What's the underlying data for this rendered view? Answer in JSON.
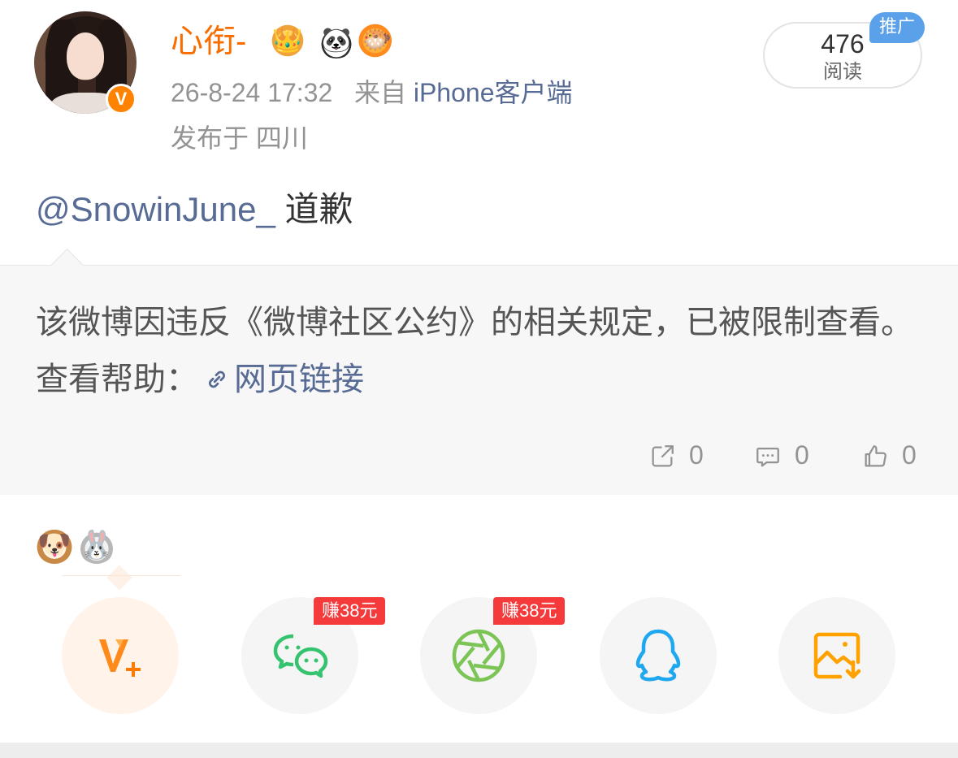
{
  "header": {
    "username": "心衔-",
    "verified_mark": "V",
    "badges": [
      {
        "name": "crown-badge-icon",
        "glyph": "👑"
      },
      {
        "name": "panda-badge-icon",
        "glyph": "🐼"
      },
      {
        "name": "fish-badge-icon",
        "glyph": "🐡"
      }
    ],
    "timestamp": "26-8-24 17:32",
    "source_prefix": "来自",
    "source": "iPhone客户端",
    "location": "发布于 四川",
    "read_count": "476",
    "read_label": "阅读",
    "promo_label": "推广"
  },
  "post": {
    "mention": "@SnowinJune_",
    "text": "道歉"
  },
  "restricted": {
    "notice": "该微博因违反《微博社区公约》的相关规定，已被限制查看。查看帮助：",
    "link_text": "网页链接",
    "actions": {
      "repost_count": "0",
      "comment_count": "0",
      "like_count": "0"
    }
  },
  "emoji_row": [
    {
      "name": "dog-emoji",
      "glyph": "🐶"
    },
    {
      "name": "rabbit-emoji",
      "glyph": "🐰"
    }
  ],
  "share": {
    "earn_tag_1": "赚38元",
    "earn_tag_2": "赚38元",
    "buttons": [
      "weibo-vplus",
      "wechat",
      "moments",
      "qq",
      "save-image"
    ]
  },
  "colors": {
    "brand_orange": "#f86d00",
    "link_blue": "#576b95",
    "promo_blue": "#5ba1ea",
    "earn_red": "#f43a3a",
    "wechat_green": "#36c36f",
    "moments_green": "#7bc455",
    "qq_blue": "#1fa7f0",
    "save_orange": "#ffa200"
  }
}
